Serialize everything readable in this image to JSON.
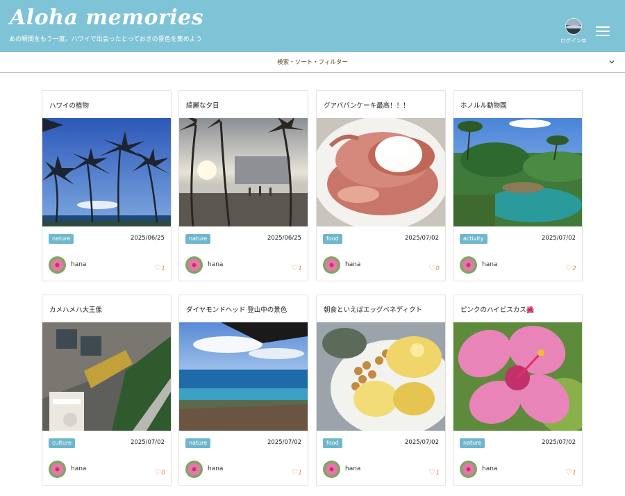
{
  "header": {
    "logo": "Aloha memories",
    "tagline": "あの瞬間をもう一度。ハワイで出会ったとっておきの景色を集めよう",
    "login_label": "ログイン中"
  },
  "filter": {
    "label": "検索・ソート・フィルター"
  },
  "colors": {
    "header_bg": "#7fc3d6",
    "tag_bg": "#6fb7cd",
    "like": "#e4845e"
  },
  "posts": [
    {
      "title": "ハワイの植物",
      "tag": "nature",
      "date": "2025/06/25",
      "user": "hana",
      "likes": "1"
    },
    {
      "title": "綺麗な夕日",
      "tag": "nature",
      "date": "2025/06/25",
      "user": "hana",
      "likes": "1"
    },
    {
      "title": "グアバパンケーキ最高！！！",
      "tag": "food",
      "date": "2025/07/02",
      "user": "hana",
      "likes": "0"
    },
    {
      "title": "ホノルル動物園",
      "tag": "activity",
      "date": "2025/07/02",
      "user": "hana",
      "likes": "2"
    },
    {
      "title": "カメハメハ大王像",
      "tag": "culture",
      "date": "2025/07/02",
      "user": "hana",
      "likes": "0"
    },
    {
      "title": "ダイヤモンドヘッド 登山中の景色",
      "tag": "nature",
      "date": "2025/07/02",
      "user": "hana",
      "likes": "1"
    },
    {
      "title": "朝食といえばエッグベネディクト",
      "tag": "food",
      "date": "2025/07/02",
      "user": "hana",
      "likes": "1"
    },
    {
      "title": "ピンクのハイビスカス🌺",
      "tag": "nature",
      "date": "2025/07/02",
      "user": "hana",
      "likes": "1"
    }
  ]
}
